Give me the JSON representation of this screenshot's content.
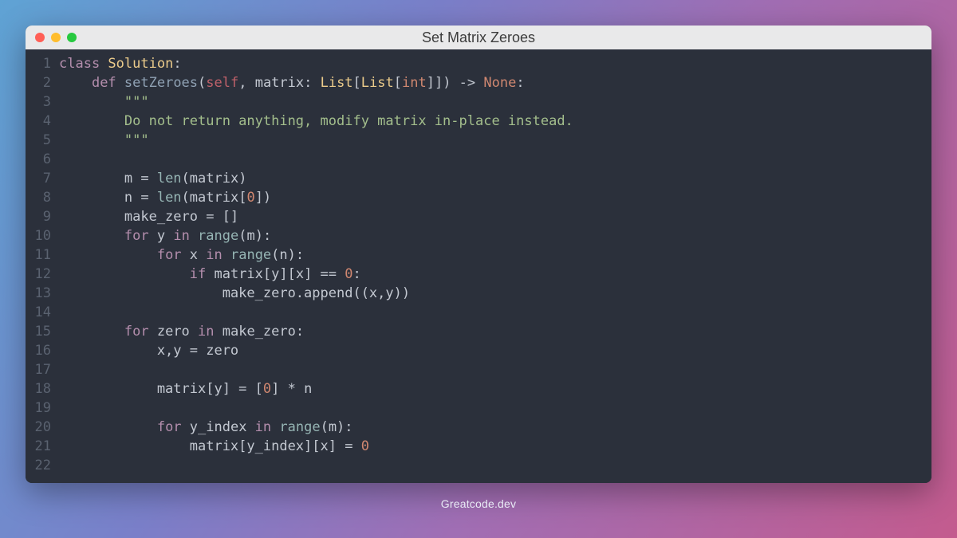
{
  "window": {
    "title": "Set Matrix Zeroes"
  },
  "footer": {
    "text": "Greatcode.dev"
  },
  "gutter": {
    "start": 1,
    "end": 22
  },
  "code": {
    "lines": [
      [
        {
          "t": "class ",
          "c": "kw"
        },
        {
          "t": "Solution",
          "c": "cls"
        },
        {
          "t": ":",
          "c": "pn"
        }
      ],
      [
        {
          "t": "    ",
          "c": "pn"
        },
        {
          "t": "def ",
          "c": "def"
        },
        {
          "t": "setZeroes",
          "c": "fn"
        },
        {
          "t": "(",
          "c": "pn"
        },
        {
          "t": "self",
          "c": "self"
        },
        {
          "t": ", matrix: ",
          "c": "pn"
        },
        {
          "t": "List",
          "c": "type"
        },
        {
          "t": "[",
          "c": "pn"
        },
        {
          "t": "List",
          "c": "type"
        },
        {
          "t": "[",
          "c": "pn"
        },
        {
          "t": "int",
          "c": "ctype"
        },
        {
          "t": "]]) -> ",
          "c": "pn"
        },
        {
          "t": "None",
          "c": "const"
        },
        {
          "t": ":",
          "c": "pn"
        }
      ],
      [
        {
          "t": "        \"\"\"",
          "c": "str"
        }
      ],
      [
        {
          "t": "        Do not return anything, modify matrix in-place instead.",
          "c": "str"
        }
      ],
      [
        {
          "t": "        \"\"\"",
          "c": "str"
        }
      ],
      [
        {
          "t": " ",
          "c": "pn"
        }
      ],
      [
        {
          "t": "        m = ",
          "c": "id"
        },
        {
          "t": "len",
          "c": "builtin2"
        },
        {
          "t": "(matrix)",
          "c": "pn"
        }
      ],
      [
        {
          "t": "        n = ",
          "c": "id"
        },
        {
          "t": "len",
          "c": "builtin2"
        },
        {
          "t": "(matrix[",
          "c": "pn"
        },
        {
          "t": "0",
          "c": "num"
        },
        {
          "t": "])",
          "c": "pn"
        }
      ],
      [
        {
          "t": "        make_zero = []",
          "c": "id"
        }
      ],
      [
        {
          "t": "        ",
          "c": "pn"
        },
        {
          "t": "for ",
          "c": "kw"
        },
        {
          "t": "y ",
          "c": "id"
        },
        {
          "t": "in ",
          "c": "kw"
        },
        {
          "t": "range",
          "c": "builtin2"
        },
        {
          "t": "(m):",
          "c": "pn"
        }
      ],
      [
        {
          "t": "            ",
          "c": "pn"
        },
        {
          "t": "for ",
          "c": "kw"
        },
        {
          "t": "x ",
          "c": "id"
        },
        {
          "t": "in ",
          "c": "kw"
        },
        {
          "t": "range",
          "c": "builtin2"
        },
        {
          "t": "(n):",
          "c": "pn"
        }
      ],
      [
        {
          "t": "                ",
          "c": "pn"
        },
        {
          "t": "if ",
          "c": "kw"
        },
        {
          "t": "matrix[y][x] == ",
          "c": "id"
        },
        {
          "t": "0",
          "c": "num"
        },
        {
          "t": ":",
          "c": "pn"
        }
      ],
      [
        {
          "t": "                    make_zero.append((x,y))",
          "c": "id"
        }
      ],
      [
        {
          "t": " ",
          "c": "pn"
        }
      ],
      [
        {
          "t": "        ",
          "c": "pn"
        },
        {
          "t": "for ",
          "c": "kw"
        },
        {
          "t": "zero ",
          "c": "id"
        },
        {
          "t": "in ",
          "c": "kw"
        },
        {
          "t": "make_zero:",
          "c": "id"
        }
      ],
      [
        {
          "t": "            x,y = zero",
          "c": "id"
        }
      ],
      [
        {
          "t": " ",
          "c": "pn"
        }
      ],
      [
        {
          "t": "            matrix[y] = [",
          "c": "id"
        },
        {
          "t": "0",
          "c": "num"
        },
        {
          "t": "] * n",
          "c": "id"
        }
      ],
      [
        {
          "t": " ",
          "c": "pn"
        }
      ],
      [
        {
          "t": "            ",
          "c": "pn"
        },
        {
          "t": "for ",
          "c": "kw"
        },
        {
          "t": "y_index ",
          "c": "id"
        },
        {
          "t": "in ",
          "c": "kw"
        },
        {
          "t": "range",
          "c": "builtin2"
        },
        {
          "t": "(m):",
          "c": "pn"
        }
      ],
      [
        {
          "t": "                matrix[y_index][x] = ",
          "c": "id"
        },
        {
          "t": "0",
          "c": "num"
        }
      ],
      [
        {
          "t": " ",
          "c": "pn"
        }
      ]
    ]
  }
}
